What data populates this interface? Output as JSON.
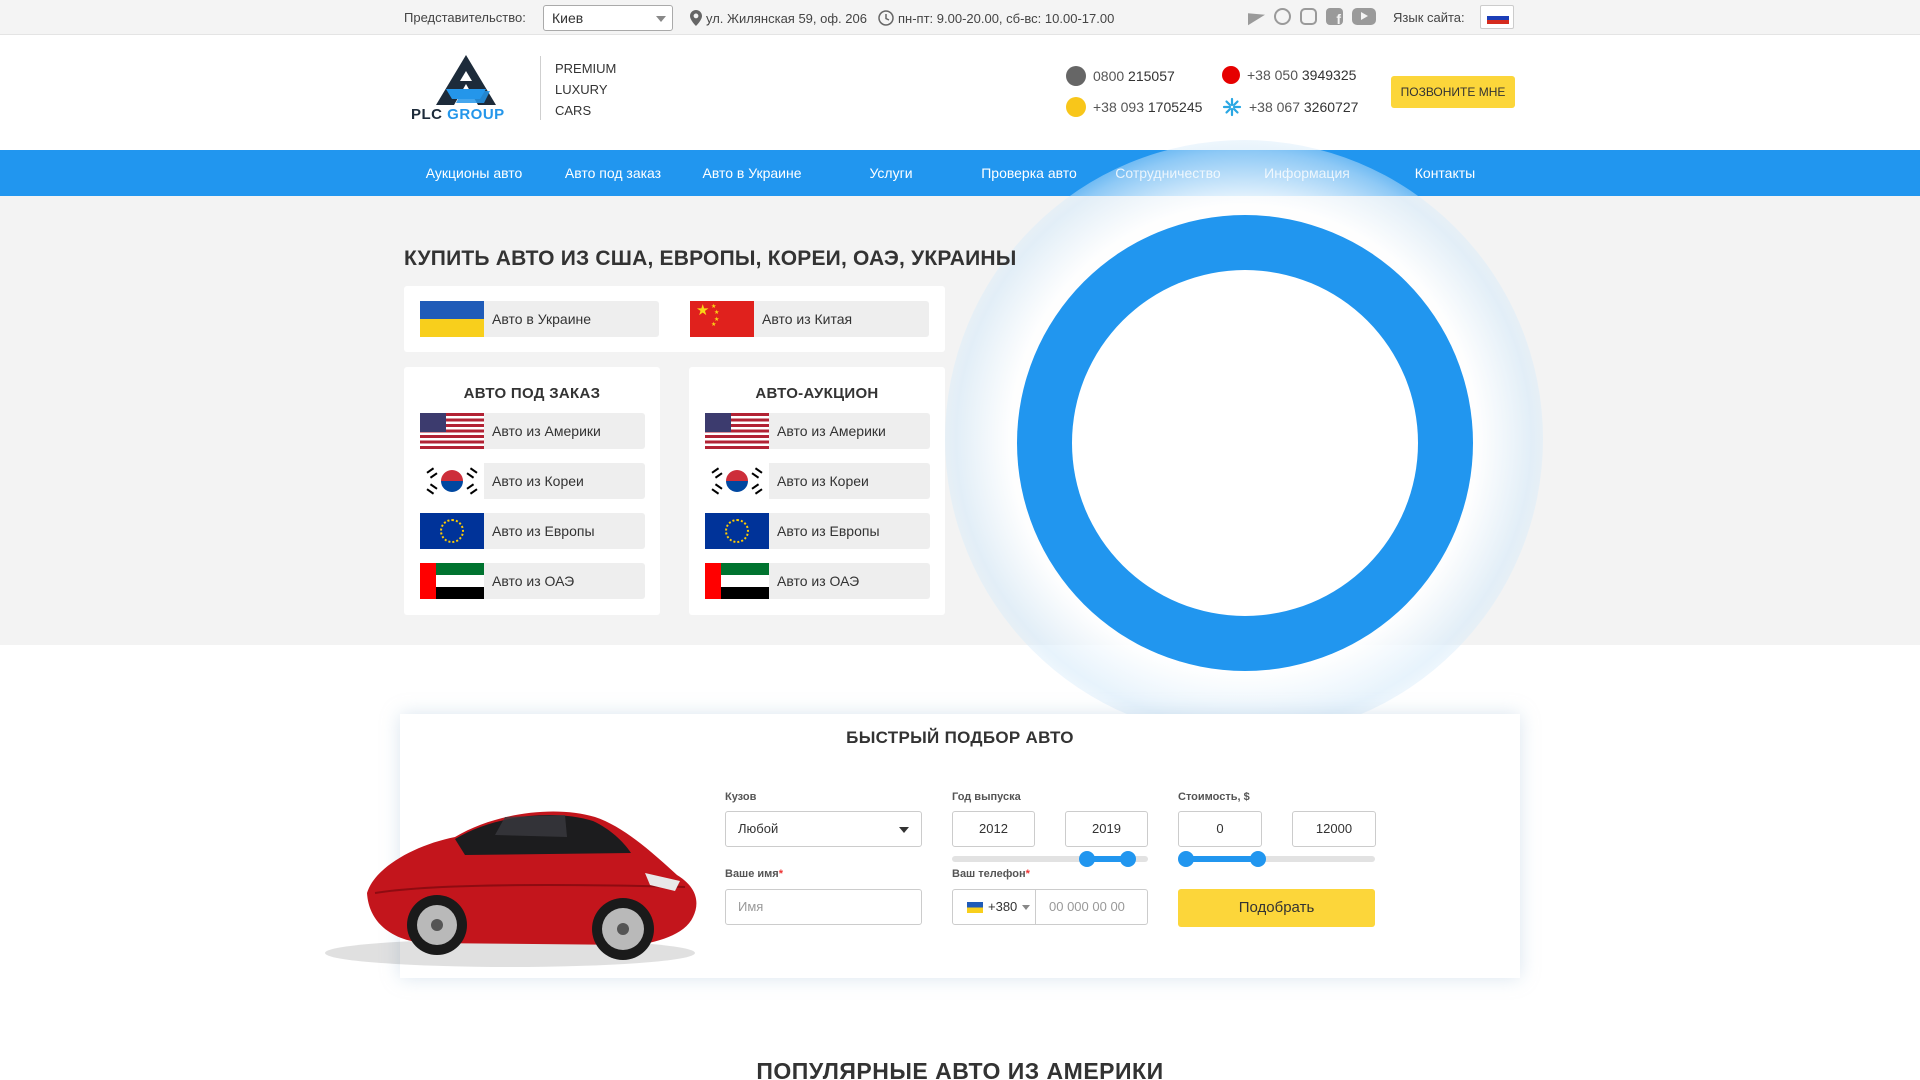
{
  "topbar": {
    "office_label": "Представительство:",
    "office_value": "Киев",
    "address": "ул. Жилянская 59, оф. 206",
    "hours": "пн-пт: 9.00-20.00, сб-вс: 10.00-17.00",
    "social_icons": [
      "telegram-icon",
      "viber-icon",
      "instagram-icon",
      "facebook-icon",
      "youtube-icon"
    ],
    "language_label": "Язык сайта:",
    "language_flag": "flag-ru-icon"
  },
  "header": {
    "logo_word1": "PLC ",
    "logo_word2": "GROUP",
    "tagline": [
      "PREMIUM",
      "LUXURY",
      "CARS"
    ],
    "phones": [
      {
        "prefix": "0800 ",
        "number": "215057",
        "icon": "phone-icon"
      },
      {
        "prefix": "+38 050 ",
        "number": "3949325",
        "icon": "vodafone-icon"
      },
      {
        "prefix": "+38 093 ",
        "number": "1705245",
        "icon": "lifecell-icon"
      },
      {
        "prefix": "+38 067 ",
        "number": "3260727",
        "icon": "kyivstar-icon"
      }
    ],
    "callback_label": "ПОЗВОНИТЕ МНЕ"
  },
  "nav": {
    "items": [
      "Аукционы авто",
      "Авто под заказ",
      "Авто в Украине",
      "Услуги",
      "Проверка авто",
      "Сотрудничество",
      "Информация",
      "Контакты"
    ]
  },
  "hero": {
    "title": "КУПИТЬ АВТО ИЗ США, ЕВРОПЫ, КОРЕИ, ОАЭ, УКРАИНЫ",
    "top_links": [
      {
        "label": "Авто в Украине",
        "flag": "ukraine"
      },
      {
        "label": "Авто из Китая",
        "flag": "china"
      }
    ],
    "order_card": {
      "title": "АВТО ПОД ЗАКАЗ",
      "items": [
        {
          "label": "Авто из Америки",
          "flag": "usa"
        },
        {
          "label": "Авто из Кореи",
          "flag": "korea"
        },
        {
          "label": "Авто из Европы",
          "flag": "eu"
        },
        {
          "label": "Авто из ОАЭ",
          "flag": "uae"
        }
      ]
    },
    "auction_card": {
      "title": "АВТО-АУКЦИОН",
      "items": [
        {
          "label": "Авто из Америки",
          "flag": "usa"
        },
        {
          "label": "Авто из Кореи",
          "flag": "korea"
        },
        {
          "label": "Авто из Европы",
          "flag": "eu"
        },
        {
          "label": "Авто из ОАЭ",
          "flag": "uae"
        }
      ]
    }
  },
  "quick_select": {
    "title": "БЫСТРЫЙ ПОДБОР АВТО",
    "body_label": "Кузов",
    "body_value": "Любой",
    "year_label": "Год выпуска",
    "year_from": "2012",
    "year_to": "2019",
    "price_label": "Стоимость, $",
    "price_from": "0",
    "price_to": "12000",
    "name_label": "Ваше имя",
    "name_placeholder": "Имя",
    "phone_label": "Ваш телефон",
    "phone_code": "+380",
    "phone_placeholder": "00 000 00 00",
    "required_mark": "*",
    "submit_label": "Подобрать"
  },
  "popular_title": "ПОПУЛЯРНЫЕ АВТО ИЗ АМЕРИКИ",
  "colors": {
    "accent_blue": "#2196ef",
    "accent_yellow": "#fcd63a",
    "text": "#333333"
  }
}
